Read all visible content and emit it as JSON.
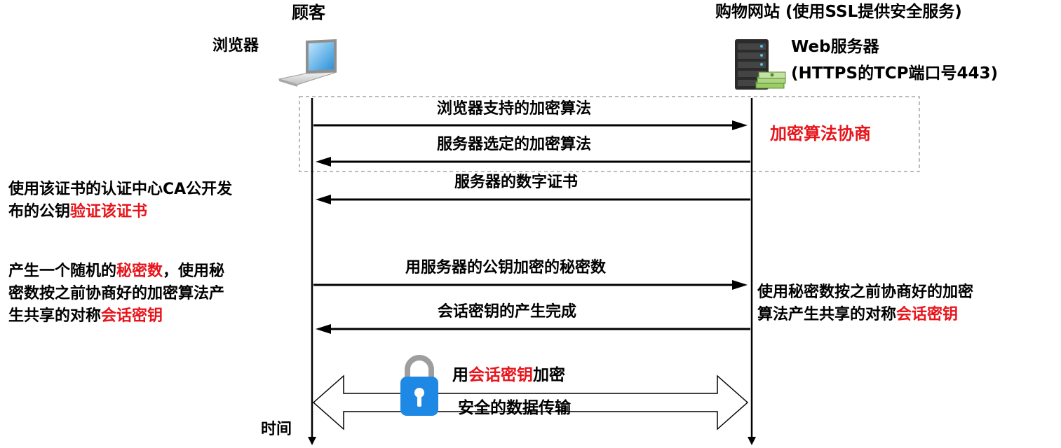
{
  "customer": {
    "title": "顾客",
    "browser_label": "浏览器"
  },
  "shop": {
    "title": "购物网站 (使用SSL提供安全服务)",
    "server_line1": "Web服务器",
    "server_line2": "(HTTPS的TCP端口号443)"
  },
  "negotiation": {
    "label": "加密算法协商"
  },
  "messages": [
    {
      "text": "浏览器支持的加密算法",
      "direction": "to-server"
    },
    {
      "text": "服务器选定的加密算法",
      "direction": "to-client"
    },
    {
      "text": "服务器的数字证书",
      "direction": "to-client"
    },
    {
      "text": "用服务器的公钥加密的秘密数",
      "direction": "to-server"
    },
    {
      "text": "会话密钥的产生完成",
      "direction": "to-client"
    }
  ],
  "left_notes": {
    "verify": {
      "line1": "使用该证书的认证中心CA公开发",
      "line2_prefix": "布的公钥",
      "line2_highlight": "验证该证书"
    },
    "secret": {
      "line1_prefix": "产生一个随机的",
      "line1_highlight": "秘密数",
      "line1_suffix": "，使用秘",
      "line2": "密数按之前协商好的加密算法产",
      "line3_prefix": "生共享的对称",
      "line3_highlight": "会话密钥"
    }
  },
  "right_note": {
    "line1": "使用秘密数按之前协商好的加密",
    "line2_prefix": "算法产生共享的对称",
    "line2_highlight": "会话密钥"
  },
  "secure": {
    "line1_prefix": "用",
    "line1_highlight": "会话密钥",
    "line1_suffix": "加密",
    "line2": "安全的数据传输"
  },
  "time_label": "时间",
  "colors": {
    "highlight": "#e8141b",
    "text": "#000000",
    "lock_body": "#1e88e5",
    "lock_shackle": "#9e9e9e"
  }
}
